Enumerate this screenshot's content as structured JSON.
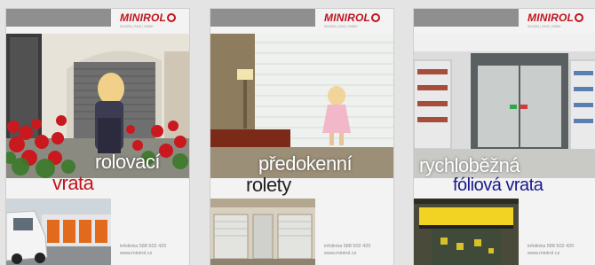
{
  "brand": {
    "logo_text": "MINIROL",
    "tagline": "SIGURA | SAIS | GMBH"
  },
  "colors": {
    "brand_red": "#c0141d",
    "title_blue": "#1a1a8c",
    "bar_gray": "#8f8f8f"
  },
  "brochures": [
    {
      "headline_line1": "rolovací",
      "headline_line2": "vrata",
      "line2_color": "#c0141d",
      "contact_phone": "infolinka 588 502 420",
      "contact_web": "www.minirol.cz",
      "main_photo": "garage-door-with-flowers-and-child",
      "small_photo": "white-van-with-orange-doors"
    },
    {
      "headline_line1": "předokenní",
      "headline_line2": "rolety",
      "line2_color": "#222222",
      "contact_phone": "infolinka 588 502 420",
      "contact_web": "www.minirol.cz",
      "main_photo": "child-at-window-with-blinds",
      "small_photo": "house-windows-with-shutters"
    },
    {
      "headline_line1": "rychloběžná",
      "headline_line2": "fóliová vrata",
      "line2_color": "#1a1a8c",
      "contact_phone": "infolinka 588 502 420",
      "contact_web": "www.minirol.cz",
      "main_photo": "supermarket-high-speed-door",
      "small_photo": "industrial-yellow-door"
    }
  ]
}
